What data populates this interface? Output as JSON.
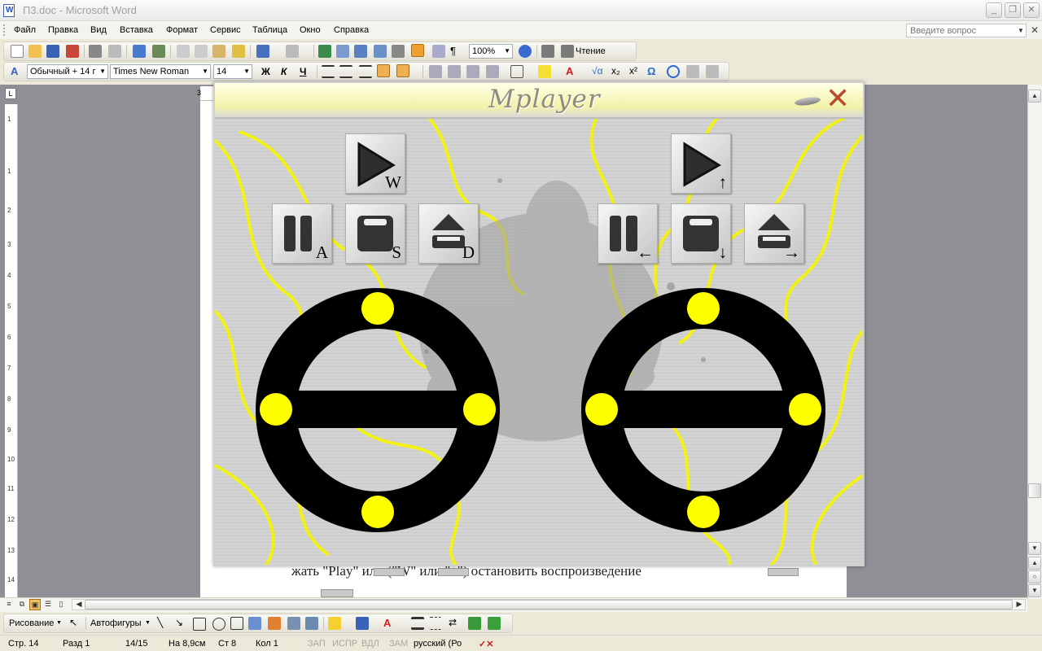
{
  "window": {
    "title": "П3.doc - Microsoft Word",
    "minimize": "_",
    "restore": "❐",
    "close": "✕"
  },
  "menu": {
    "items": [
      "Файл",
      "Правка",
      "Вид",
      "Вставка",
      "Формат",
      "Сервис",
      "Таблица",
      "Окно",
      "Справка"
    ],
    "question_placeholder": "Введите вопрос"
  },
  "standard_toolbar": {
    "zoom": "100%",
    "reading_label": "Чтение"
  },
  "format_toolbar": {
    "style": "Обычный + 14 г",
    "font": "Times New Roman",
    "size": "14",
    "bold": "Ж",
    "italic": "К",
    "underline": "Ч"
  },
  "ruler": {
    "tab_marker": "L",
    "h_num": "3",
    "v_numbers": [
      "1",
      "1",
      "2",
      "3",
      "4",
      "5",
      "6",
      "7",
      "8",
      "9",
      "10",
      "11",
      "12",
      "13",
      "14"
    ]
  },
  "document": {
    "line_text": "жать \"Play\"       или        (\"W\" или \"↑\")  остановить воспроизведение"
  },
  "mplayer": {
    "title": "Mplayer",
    "close_glyph": "✕",
    "player1": {
      "play_key": "W",
      "pause_key": "A",
      "stop_key": "S",
      "eject_key": "D"
    },
    "player2": {
      "play_key": "↑",
      "pause_key": "←",
      "stop_key": "↓",
      "eject_key": "→"
    },
    "colors": {
      "accent": "#ffff00",
      "ring": "#000000",
      "close": "#b84a2e"
    }
  },
  "drawbar": {
    "drawing": "Рисование",
    "autoshapes": "Автофигуры"
  },
  "status": {
    "page": "Стр. 14",
    "section": "Разд 1",
    "pages": "14/15",
    "at": "На 8,9см",
    "line": "Ст 8",
    "col": "Кол 1",
    "rec": "ЗАП",
    "trk": "ИСПР",
    "ext": "ВДЛ",
    "ovr": "ЗАМ",
    "lang": "русский (Ро"
  }
}
